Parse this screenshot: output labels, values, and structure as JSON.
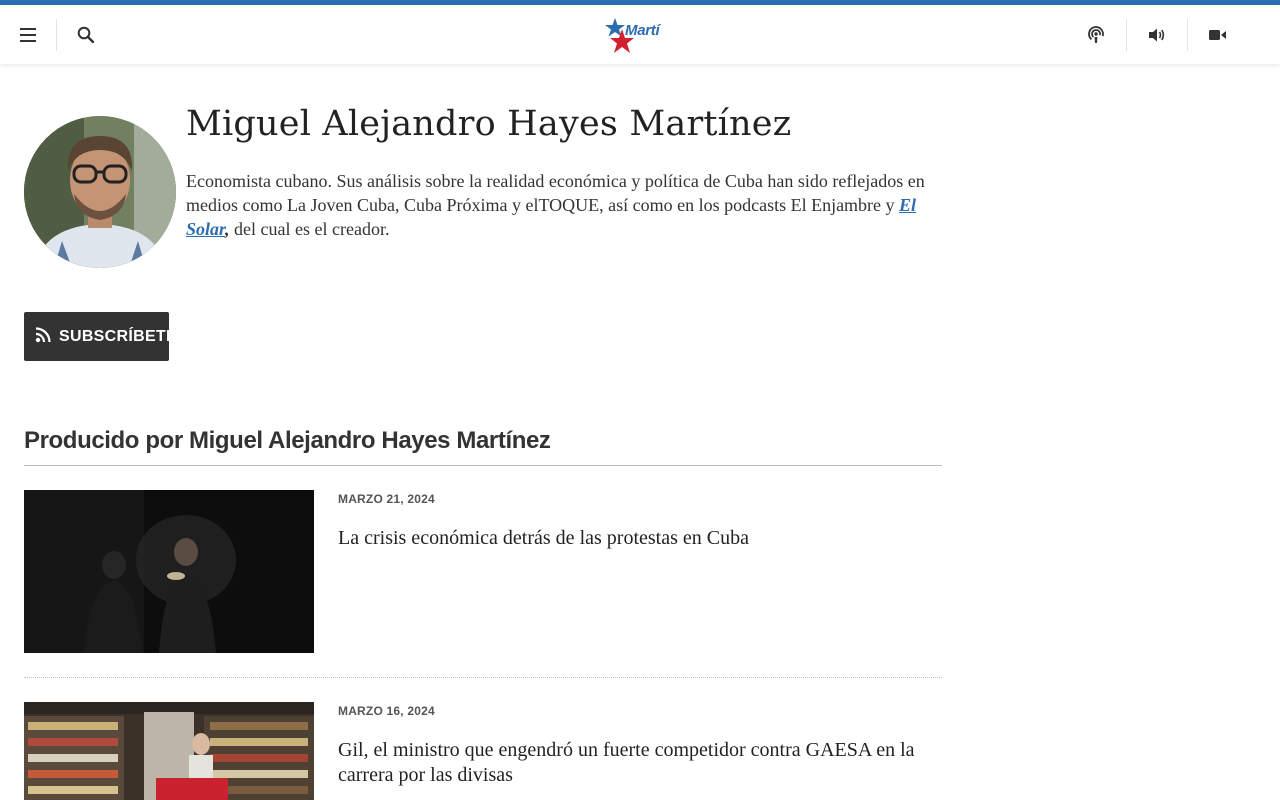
{
  "header": {
    "logo_text": "Martí",
    "icons": {
      "menu": "hamburger-menu-icon",
      "search": "search-icon",
      "podcast": "podcast-icon",
      "audio": "speaker-icon",
      "video": "video-camera-icon"
    },
    "accent_color": "#2c6cb0"
  },
  "author": {
    "name": "Miguel Alejandro Hayes Martínez",
    "bio_part1": "Economista cubano. Sus análisis sobre la realidad económica y política de Cuba han sido reflejados en medios como La Joven Cuba, Cuba Próxima y elTOQUE, así como en los podcasts El Enjambre y ",
    "bio_link": "El Solar",
    "bio_comma": ",",
    "bio_part2": " del cual es el creador."
  },
  "subscribe": {
    "label": "SUBSCRÍBETE",
    "icon": "rss-icon"
  },
  "section": {
    "title": "Producido por Miguel Alejandro Hayes Martínez"
  },
  "articles": [
    {
      "date": "MARZO 21, 2024",
      "headline": "La crisis económica detrás de las protestas en Cuba"
    },
    {
      "date": "MARZO 16, 2024",
      "headline": "Gil, el ministro que engendró un fuerte competidor contra GAESA en la carrera por las divisas"
    }
  ]
}
